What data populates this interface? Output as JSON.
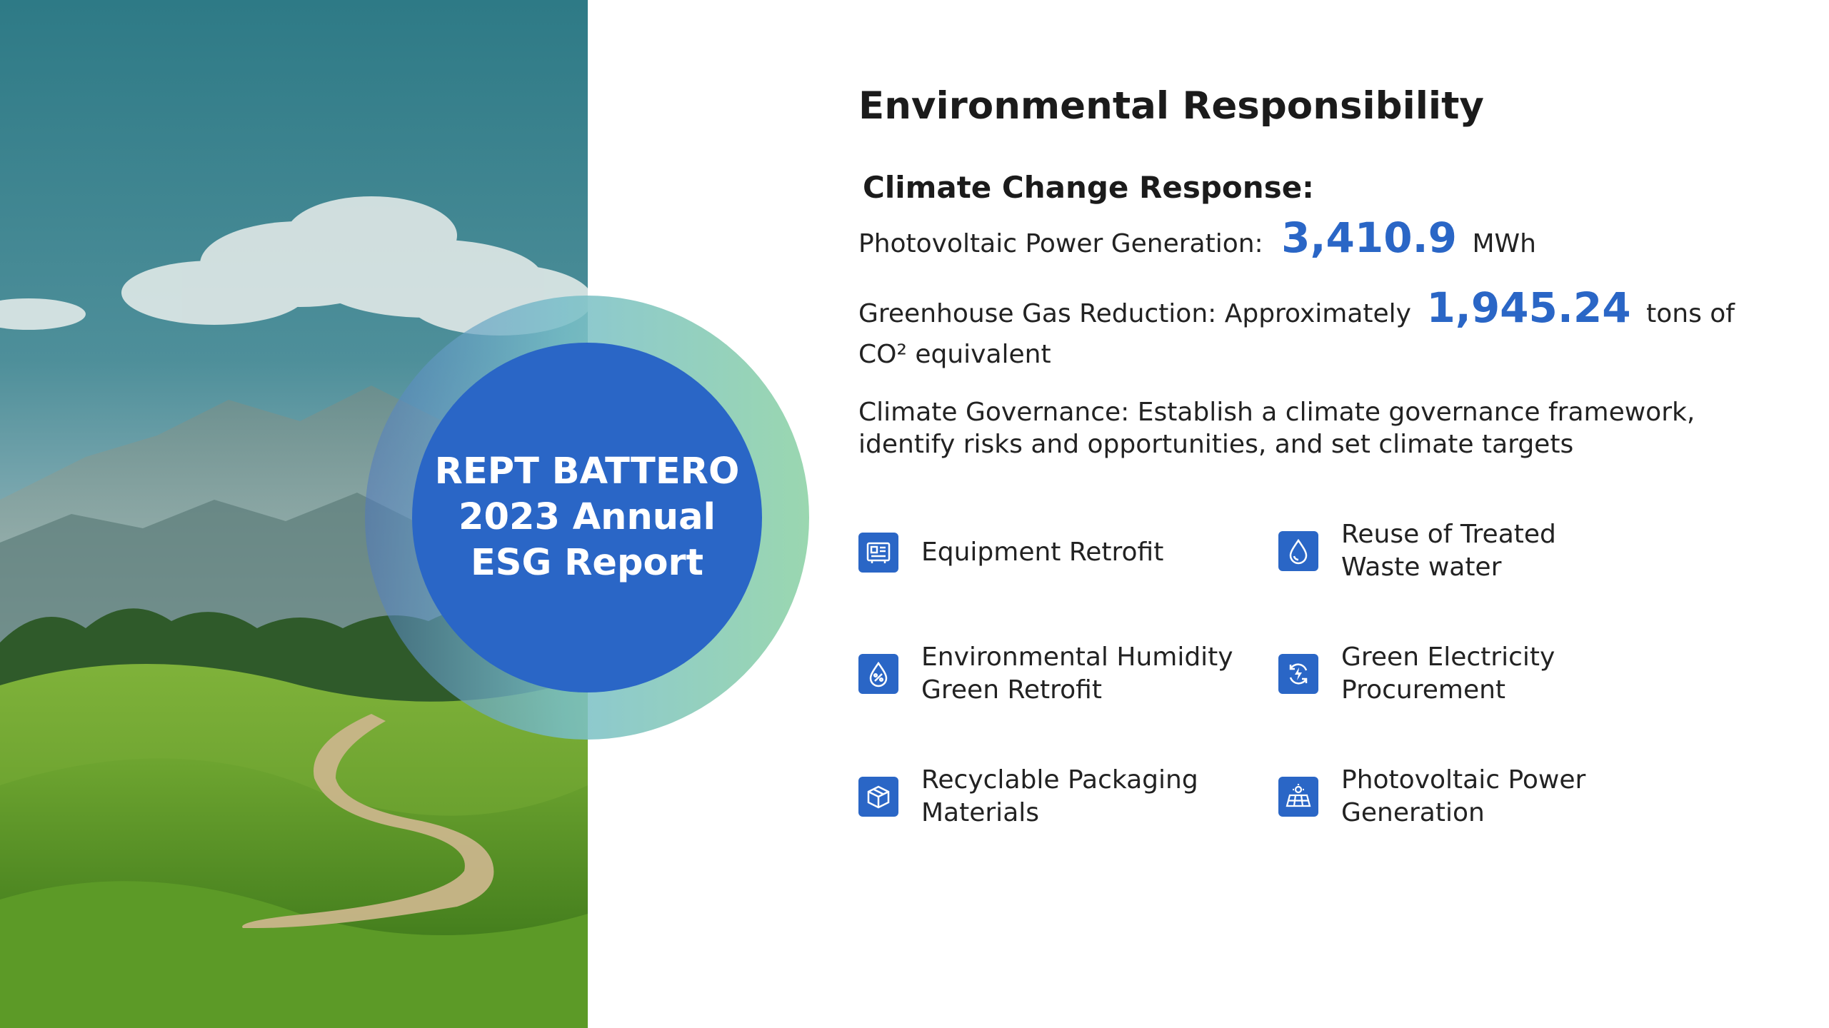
{
  "badge": {
    "line1": "REPT BATTERO",
    "line2": "2023 Annual",
    "line3": "ESG Report"
  },
  "heading": "Environmental Responsibility",
  "subheading": "Climate Change Response:",
  "pv": {
    "label": "Photovoltaic Power Generation:",
    "value": "3,410.9",
    "unit": "MWh"
  },
  "ghg": {
    "label": "Greenhouse Gas Reduction: Approximately",
    "value": "1,945.24",
    "unit": "tons of",
    "unit_line2": "CO² equivalent"
  },
  "governance": {
    "line1": "Climate Governance: Establish a climate governance framework,",
    "line2": "identify risks and opportunities, and set climate targets"
  },
  "initiatives": [
    {
      "icon": "equipment-icon",
      "line1": "Equipment Retrofit",
      "line2": ""
    },
    {
      "icon": "water-drop-icon",
      "line1": "Reuse of Treated",
      "line2": "Waste water"
    },
    {
      "icon": "humidity-icon",
      "line1": "Environmental Humidity",
      "line2": "Green Retrofit"
    },
    {
      "icon": "green-electricity-icon",
      "line1": "Green Electricity",
      "line2": "Procurement"
    },
    {
      "icon": "package-icon",
      "line1": "Recyclable Packaging",
      "line2": "Materials"
    },
    {
      "icon": "solar-panel-icon",
      "line1": "Photovoltaic Power",
      "line2": "Generation"
    }
  ],
  "colors": {
    "accent": "#2a66c6",
    "ring_end": "#9ad7b0"
  }
}
